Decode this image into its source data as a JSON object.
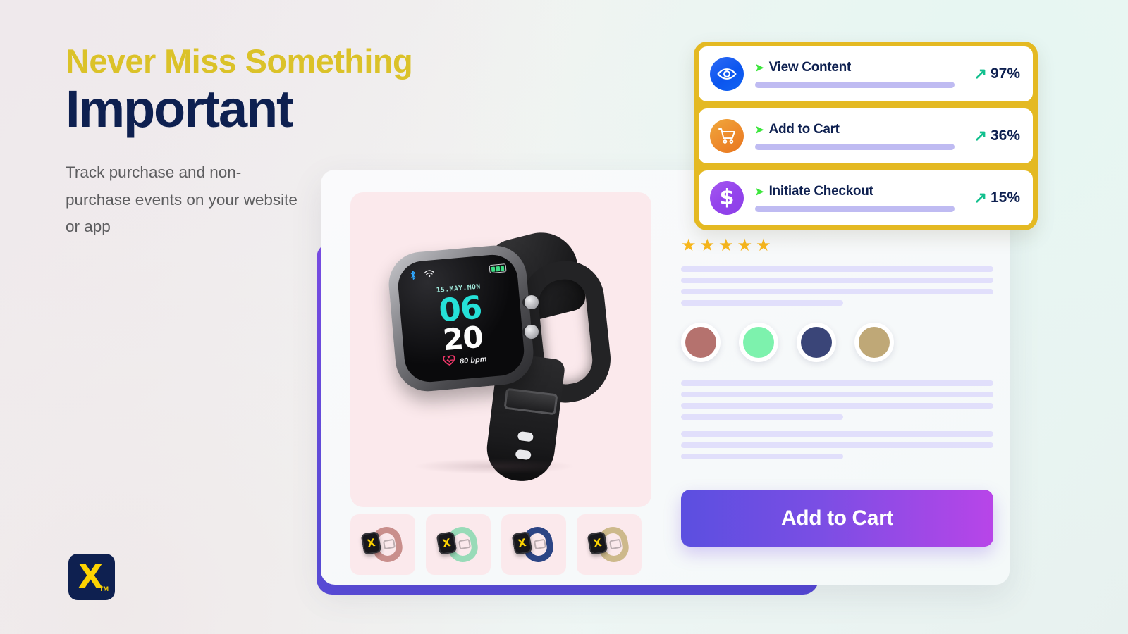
{
  "hero": {
    "kicker": "Never Miss Something",
    "title": "Important",
    "subtitle": "Track purchase and non-purchase events on your website or app",
    "kicker_color": "#dbc229",
    "title_color": "#0e2050"
  },
  "logo": {
    "mark": "X",
    "trademark": "TM",
    "background_color": "#0e2050",
    "mark_color": "#fcd302"
  },
  "metrics": {
    "frame_color": "#e4b922",
    "items": [
      {
        "icon": "eye-icon",
        "marker": "➤",
        "label": "View Content",
        "trend_icon": "↗",
        "value": "97%",
        "bar_fill_percent": 91,
        "icon_color": "#0b55ef"
      },
      {
        "icon": "shopping-cart-icon",
        "marker": "➤",
        "label": "Add to Cart",
        "trend_icon": "↗",
        "value": "36%",
        "bar_fill_percent": 91,
        "icon_color": "#ed8a2c"
      },
      {
        "icon": "dollar-icon",
        "marker": "➤",
        "label": "Initiate Checkout",
        "trend_icon": "↗",
        "value": "15%",
        "bar_fill_percent": 91,
        "icon_color": "#9444ec"
      }
    ]
  },
  "product": {
    "watch": {
      "date": "15.MAY.MON",
      "hours": "06",
      "minutes": "20",
      "heart_rate": "80 bpm",
      "heart_icon": "♥",
      "bluetooth_icon": "ᛗ",
      "wifi_icon": "◓",
      "hours_color": "#25e0d8",
      "minutes_color": "#fdfdfd"
    },
    "thumbnails": [
      {
        "name": "rose-band-thumbnail",
        "band_color": "#c98f8c",
        "mark": "X"
      },
      {
        "name": "mint-band-thumbnail",
        "band_color": "#98dbb8",
        "mark": "X"
      },
      {
        "name": "navy-band-thumbnail",
        "band_color": "#2c4585",
        "mark": "X"
      },
      {
        "name": "khaki-band-thumbnail",
        "band_color": "#cdb98b",
        "mark": "X"
      }
    ],
    "rating": {
      "stars_filled": 5,
      "star_glyph": "★",
      "star_color": "#f8b71c"
    },
    "colors": [
      {
        "name": "rose",
        "hex": "#b5726e"
      },
      {
        "name": "mint",
        "hex": "#7df2ad"
      },
      {
        "name": "navy",
        "hex": "#3a4578"
      },
      {
        "name": "khaki",
        "hex": "#bfa877"
      }
    ],
    "description_line_widths_top": [
      100,
      100,
      100,
      52
    ],
    "description_line_widths_mid": [
      100,
      100,
      100,
      52
    ],
    "description_line_widths_bottom": [
      100,
      100,
      52
    ],
    "cta_label": "Add to Cart",
    "cta_gradient_from": "#5b4fe0",
    "cta_gradient_to": "#b845e8"
  }
}
